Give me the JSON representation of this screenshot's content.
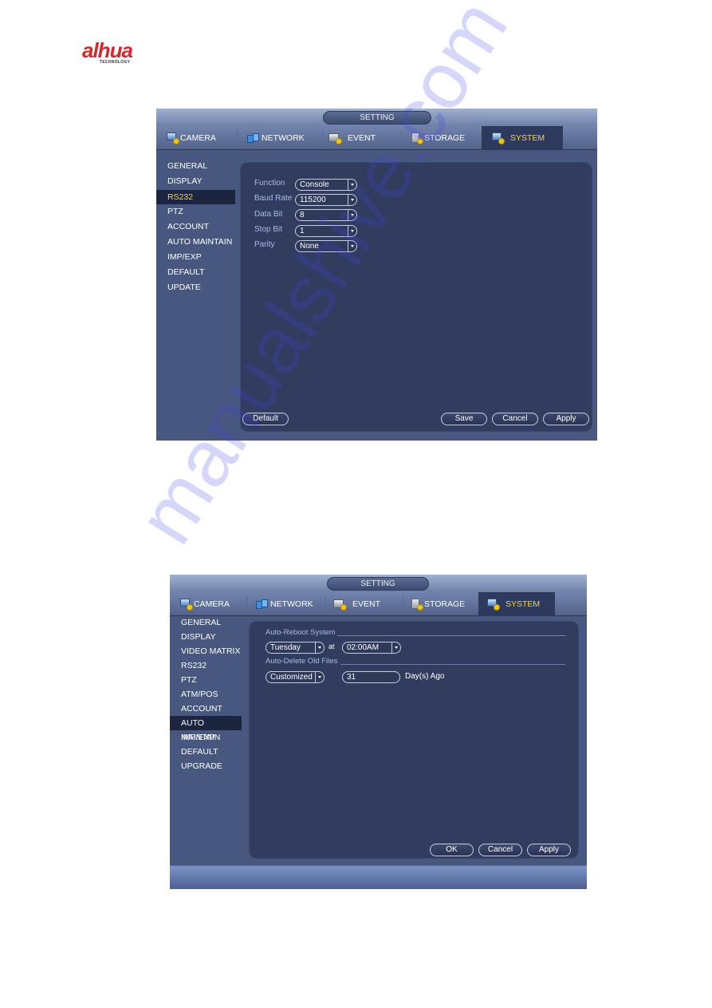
{
  "brand": {
    "logo_text": "alhua",
    "logo_sub": "TECHNOLOGY",
    "accent": "#d8262c"
  },
  "watermark": "manualshive.com",
  "screen1": {
    "title": "SETTING",
    "tabs": [
      {
        "label": "CAMERA",
        "icon": "camera-icon"
      },
      {
        "label": "NETWORK",
        "icon": "network-icon"
      },
      {
        "label": "EVENT",
        "icon": "event-icon"
      },
      {
        "label": "STORAGE",
        "icon": "storage-icon"
      },
      {
        "label": "SYSTEM",
        "icon": "system-icon",
        "active": true
      }
    ],
    "sidebar": [
      "GENERAL",
      "DISPLAY",
      "RS232",
      "PTZ",
      "ACCOUNT",
      "AUTO MAINTAIN",
      "IMP/EXP",
      "DEFAULT",
      "UPDATE"
    ],
    "sidebar_active": "RS232",
    "fields": [
      {
        "label": "Function",
        "value": "Console"
      },
      {
        "label": "Baud Rate",
        "value": "115200"
      },
      {
        "label": "Data Bit",
        "value": "8"
      },
      {
        "label": "Stop Bit",
        "value": "1"
      },
      {
        "label": "Parity",
        "value": "None"
      }
    ],
    "buttons": {
      "default": "Default",
      "save": "Save",
      "cancel": "Cancel",
      "apply": "Apply"
    }
  },
  "screen2": {
    "title": "SETTING",
    "tabs": [
      {
        "label": "CAMERA",
        "icon": "camera-icon"
      },
      {
        "label": "NETWORK",
        "icon": "network-icon"
      },
      {
        "label": "EVENT",
        "icon": "event-icon"
      },
      {
        "label": "STORAGE",
        "icon": "storage-icon"
      },
      {
        "label": "SYSTEM",
        "icon": "system-icon",
        "active": true
      }
    ],
    "sidebar": [
      "GENERAL",
      "DISPLAY",
      "VIDEO MATRIX",
      "RS232",
      "PTZ",
      "ATM/POS",
      "ACCOUNT",
      "AUTO MAINTAIN",
      "IMP/EXP",
      "DEFAULT",
      "UPGRADE"
    ],
    "sidebar_active": "AUTO MAINTAIN",
    "auto_reboot": {
      "section": "Auto-Reboot System",
      "day": "Tuesday",
      "at_label": "at",
      "time": "02:00AM"
    },
    "auto_delete": {
      "section": "Auto-Delete Old Files",
      "mode": "Customized",
      "days": "31",
      "unit": "Day(s) Ago"
    },
    "buttons": {
      "ok": "OK",
      "cancel": "Cancel",
      "apply": "Apply"
    }
  }
}
